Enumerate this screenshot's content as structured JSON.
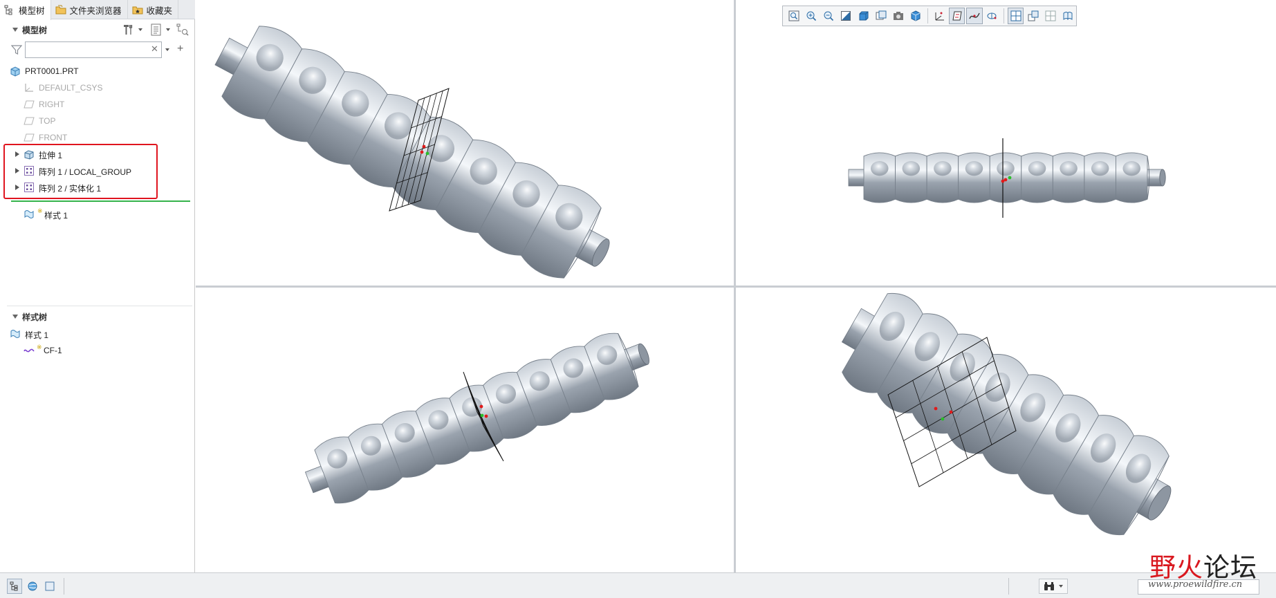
{
  "tabs": [
    {
      "label": "模型树",
      "icon": "model-tree-icon"
    },
    {
      "label": "文件夹浏览器",
      "icon": "folder-browser-icon"
    },
    {
      "label": "收藏夹",
      "icon": "favorites-icon"
    }
  ],
  "model_tree": {
    "title": "模型树",
    "search": {
      "value": "",
      "placeholder": ""
    },
    "root": "PRT0001.PRT",
    "items": [
      {
        "label": "DEFAULT_CSYS",
        "icon": "csys-icon",
        "dimmed": true
      },
      {
        "label": "RIGHT",
        "icon": "datum-plane-icon",
        "dimmed": true
      },
      {
        "label": "TOP",
        "icon": "datum-plane-icon",
        "dimmed": true
      },
      {
        "label": "FRONT",
        "icon": "datum-plane-icon",
        "dimmed": true
      },
      {
        "label": "拉伸 1",
        "icon": "extrude-icon",
        "expandable": true
      },
      {
        "label": "阵列 1 / LOCAL_GROUP",
        "icon": "pattern-icon",
        "expandable": true
      },
      {
        "label": "阵列 2 / 实体化 1",
        "icon": "pattern-icon",
        "expandable": true
      }
    ],
    "after_insert": {
      "label": "样式 1",
      "icon": "style-icon"
    }
  },
  "style_tree": {
    "title": "样式树",
    "items": [
      {
        "label": "样式 1",
        "icon": "style-icon"
      },
      {
        "label": "CF-1",
        "icon": "curve-icon"
      }
    ]
  },
  "view_toolbar": {
    "buttons": [
      "refit-icon",
      "zoom-in-icon",
      "zoom-out-icon",
      "repaint-icon",
      "shading-icon",
      "saved-views-icon",
      "named-view-icon",
      "display-style-icon",
      "datum-display-icon",
      "plane-display-icon",
      "curve-display-icon",
      "point-display-icon",
      "csys-display-icon",
      "four-views-icon",
      "active-view-icon",
      "grid-display-icon",
      "view-orient-icon"
    ],
    "active": [
      "plane-display-icon",
      "curve-display-icon",
      "four-views-icon"
    ]
  },
  "status_bar": {
    "buttons": [
      "show-tree-icon",
      "browser-icon",
      "fullscreen-icon"
    ],
    "search_icon": "binoculars-icon"
  },
  "watermark": {
    "text_a": "野火",
    "text_b": "论坛",
    "url": "www.proewildfire.cn"
  },
  "colors": {
    "highlight": "#e0141e",
    "insert_line": "#34b24a",
    "model_body": "#9aa3ae",
    "model_dark": "#6f7883"
  }
}
